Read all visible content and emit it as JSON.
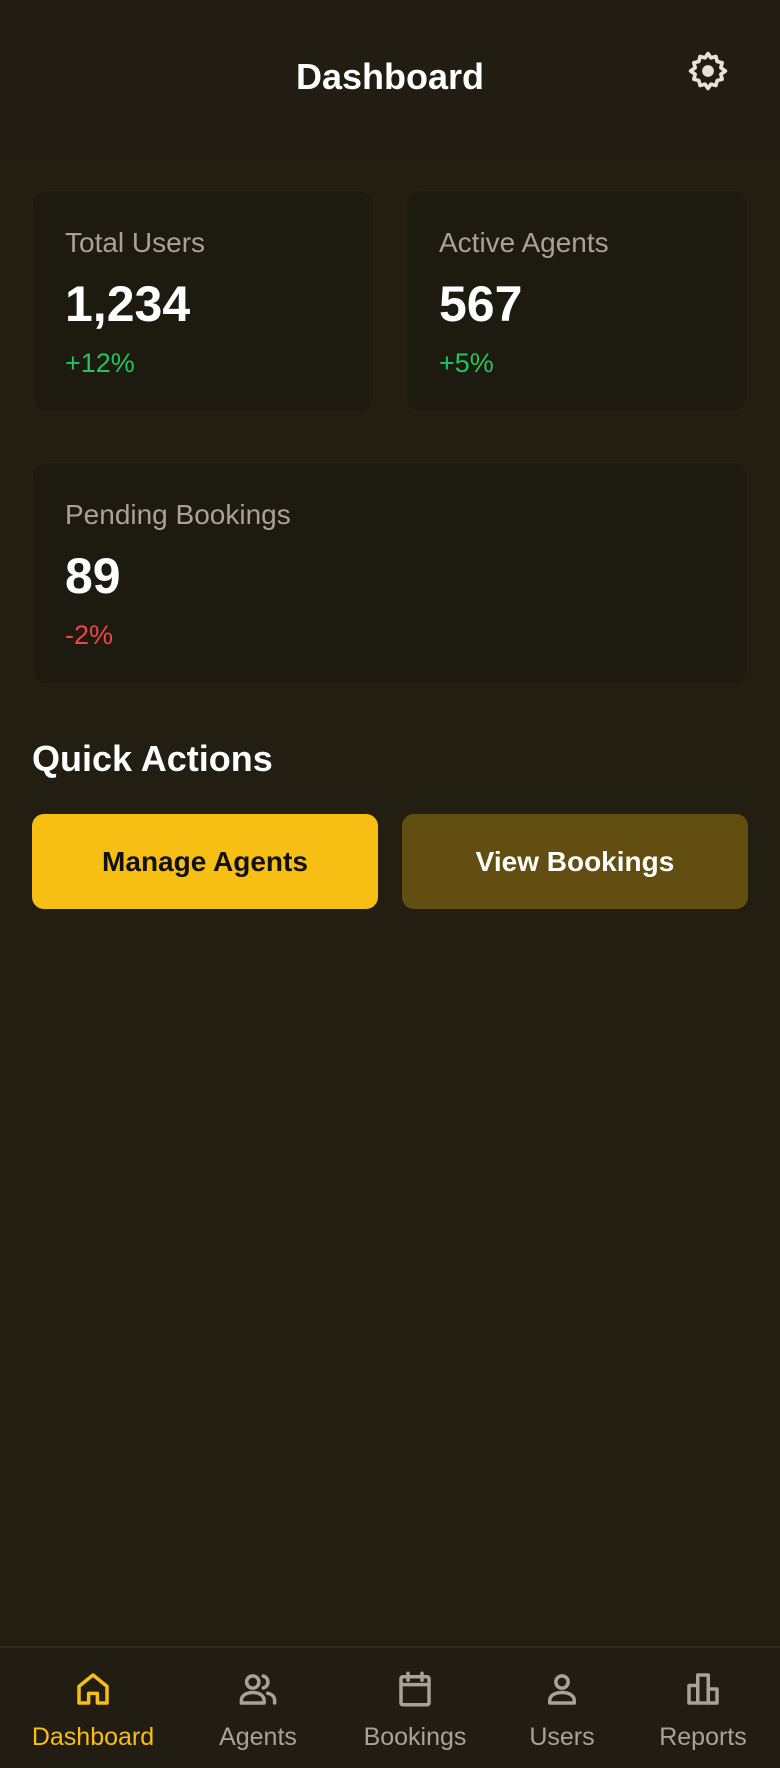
{
  "header": {
    "title": "Dashboard",
    "settings_icon": "gear-icon"
  },
  "stats": {
    "total_users": {
      "label": "Total Users",
      "value": "1,234",
      "change": "+12%",
      "trend": "up"
    },
    "active_agents": {
      "label": "Active Agents",
      "value": "567",
      "change": "+5%",
      "trend": "up"
    },
    "pending_bookings": {
      "label": "Pending Bookings",
      "value": "89",
      "change": "-2%",
      "trend": "down"
    }
  },
  "quick_actions": {
    "title": "Quick Actions",
    "manage_agents_label": "Manage Agents",
    "view_bookings_label": "View Bookings"
  },
  "nav": {
    "active": "dashboard",
    "items": [
      {
        "id": "dashboard",
        "label": "Dashboard",
        "icon": "home-icon"
      },
      {
        "id": "agents",
        "label": "Agents",
        "icon": "people-icon"
      },
      {
        "id": "bookings",
        "label": "Bookings",
        "icon": "calendar-icon"
      },
      {
        "id": "users",
        "label": "Users",
        "icon": "user-icon"
      },
      {
        "id": "reports",
        "label": "Reports",
        "icon": "bar-chart-icon"
      }
    ]
  },
  "colors": {
    "background": "#231e12",
    "card": "#1d1a10",
    "accent": "#f7be14",
    "secondary_button": "#634e11",
    "positive": "#25c25e",
    "negative": "#ec4747",
    "muted_text": "#a8a29a"
  }
}
